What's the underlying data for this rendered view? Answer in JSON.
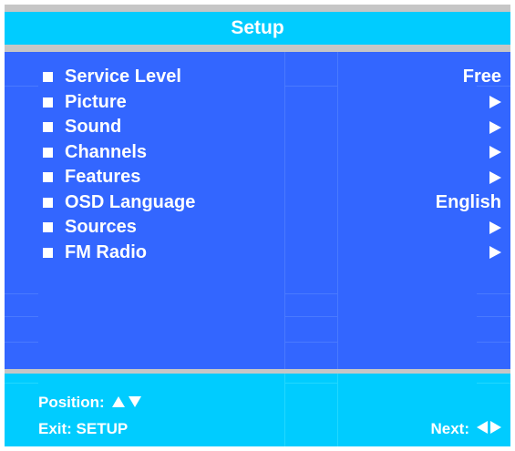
{
  "title": "Setup",
  "menu": {
    "items": [
      {
        "label": "Service Level",
        "value": "Free",
        "arrow": false
      },
      {
        "label": "Picture",
        "value": "",
        "arrow": true
      },
      {
        "label": "Sound",
        "value": "",
        "arrow": true
      },
      {
        "label": "Channels",
        "value": "",
        "arrow": true
      },
      {
        "label": "Features",
        "value": "",
        "arrow": true
      },
      {
        "label": "OSD Language",
        "value": "English",
        "arrow": false
      },
      {
        "label": "Sources",
        "value": "",
        "arrow": true
      },
      {
        "label": "FM Radio",
        "value": "",
        "arrow": true
      }
    ]
  },
  "footer": {
    "position_label": "Position:",
    "exit_label": "Exit: SETUP",
    "next_label": "Next:"
  },
  "colors": {
    "title_bar": "#00ccff",
    "menu_panel": "#3366ff",
    "frame": "#c6c6c6",
    "text": "#ffffff"
  },
  "icons": {
    "bullet": "square-bullet-icon",
    "submenu": "submenu-arrow-icon",
    "position": [
      "arrow-up-icon",
      "arrow-down-icon"
    ],
    "next": [
      "arrow-left-icon",
      "arrow-right-icon"
    ]
  }
}
